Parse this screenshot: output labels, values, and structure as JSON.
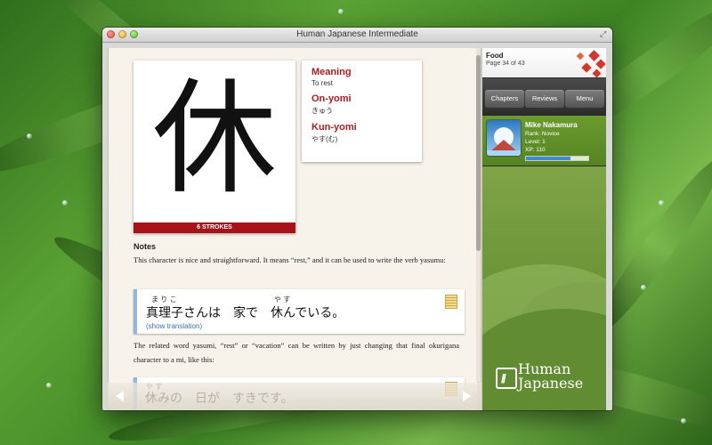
{
  "window": {
    "title": "Human Japanese Intermediate"
  },
  "kanji": {
    "character": "休",
    "strokes_label": "6 STROKES",
    "meaning_label": "Meaning",
    "meaning_value": "To rest",
    "onyomi_label": "On-yomi",
    "onyomi_value": "きゅう",
    "kunyomi_label": "Kun-yomi",
    "kunyomi_value": "やす(む)"
  },
  "notes": {
    "heading": "Notes",
    "para1": "This character is nice and straightforward. It means “rest,” and it can be used to write the verb yasumu:",
    "para2": "The related word yasumi, “rest” or “vacation” can be written by just changing that final okurigana character to a mi, like this:"
  },
  "example1": {
    "furigana_left": "ま り こ",
    "furigana_right": "や す",
    "sentence": "真理子さんは　家で　休んでいる。",
    "show_translation": "(show translation)"
  },
  "example2": {
    "furigana": "や す",
    "sentence": "休みの　日が　すきです。"
  },
  "sidebar": {
    "topic": "Food",
    "page_indicator": "Page 34 of 43",
    "tabs": [
      "Chapters",
      "Reviews",
      "Menu"
    ],
    "profile": {
      "name": "Mike Nakamura",
      "rank": "Rank: Novice",
      "level": "Level: 1",
      "xp": "XP: 110",
      "xp_progress": 0.72
    },
    "logo_line1": "Human",
    "logo_line2": "Japanese"
  },
  "colors": {
    "accent_red": "#b41c1c",
    "example_border": "#8fb7e0",
    "sidebar_green": "#6b9a2f"
  }
}
